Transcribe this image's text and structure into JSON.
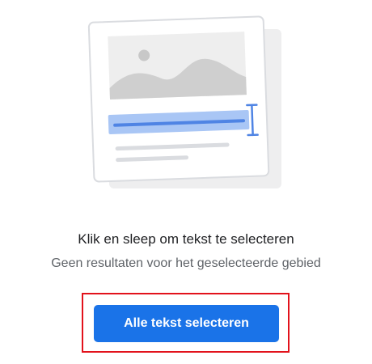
{
  "illustration": {
    "icon": "select-text-illustration-icon"
  },
  "empty_state": {
    "title": "Klik en sleep om tekst te selecteren",
    "subtitle": "Geen resultaten voor het geselecteerde gebied"
  },
  "actions": {
    "select_all_label": "Alle tekst selecteren"
  },
  "colors": {
    "accent": "#1a73e8",
    "highlight_outline": "#e2121b",
    "title_text": "#202124",
    "subtitle_text": "#5f6368"
  }
}
